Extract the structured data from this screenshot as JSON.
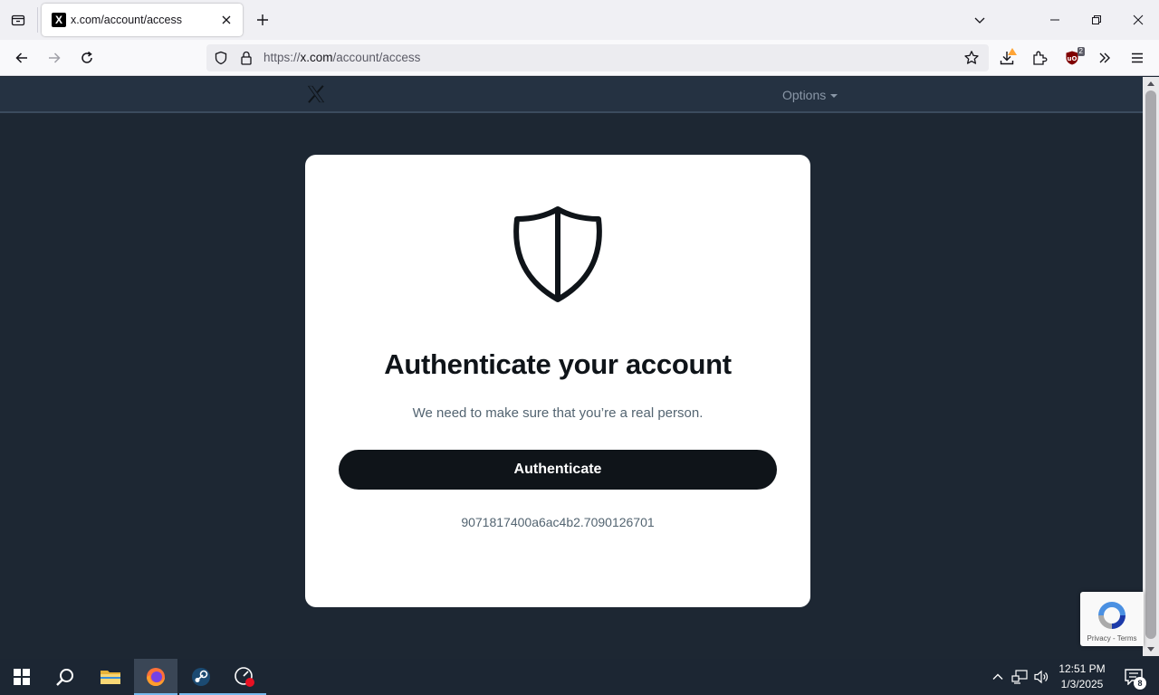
{
  "browser": {
    "tab": {
      "favicon": "X",
      "title": "x.com/account/access"
    },
    "url": {
      "prefix": "https://",
      "host": "x.com",
      "path": "/account/access"
    },
    "extension_badge": "2",
    "icons": [
      "tab-list-icon",
      "close-icon",
      "plus-icon",
      "chevron-down-icon",
      "minimize-icon",
      "restore-icon",
      "close-window-icon",
      "back-arrow-icon",
      "forward-arrow-icon",
      "reload-icon",
      "shield-icon",
      "lock-icon",
      "star-icon",
      "download-icon",
      "extensions-icon",
      "ublock-icon",
      "overflow-icon",
      "hamburger-menu-icon"
    ]
  },
  "site": {
    "logo": "X",
    "options_label": "Options",
    "card": {
      "title": "Authenticate your account",
      "subtitle": "We need to make sure that you’re a real person.",
      "button_label": "Authenticate",
      "session_id": "9071817400a6ac4b2.7090126701"
    },
    "recaptcha": {
      "links": "Privacy - Terms"
    }
  },
  "taskbar": {
    "apps": [
      "start",
      "search",
      "file-explorer",
      "firefox",
      "steam",
      "other-app"
    ],
    "clock": {
      "time": "12:51 PM",
      "date": "1/3/2025"
    },
    "notification_count": "8"
  },
  "colors": {
    "page_bg": "#1d2733",
    "header_bg": "#253242",
    "button_bg": "#0f1419",
    "taskbar_bg": "#1c2633",
    "accent": "#76b9ed"
  }
}
